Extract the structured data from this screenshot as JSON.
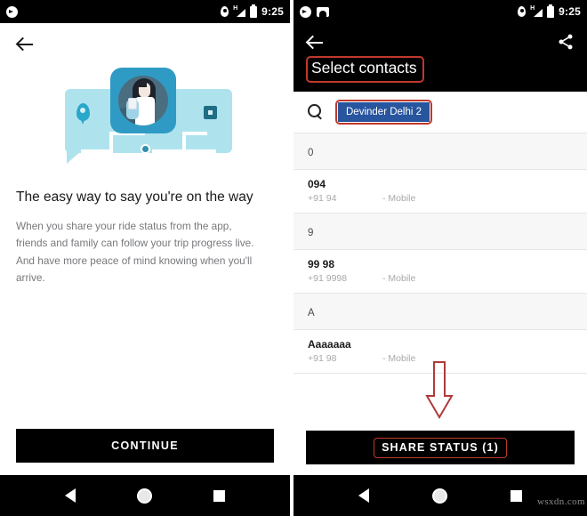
{
  "left_screen": {
    "statusbar": {
      "app_icon": "navigation-app-icon",
      "location_icon": "location-pin-icon",
      "signal_label": "H",
      "battery_icon": "battery-icon",
      "time": "9:25"
    },
    "back_button": "back-arrow",
    "illustration": {
      "name": "share-ride-status-illustration",
      "bubble_color": "#aee3ee",
      "card_color": "#2f9bc4",
      "accent_color": "#29a8c9"
    },
    "headline": "The easy way to say you're on the way",
    "paragraph": "When you share your ride status from the app, friends and family can follow your trip progress live. And have more peace of mind knowing when you'll arrive.",
    "cta_label": "CONTINUE",
    "navbar": {
      "back": "back-triangle",
      "home": "home-circle",
      "recents": "recents-square"
    }
  },
  "right_screen": {
    "statusbar": {
      "app_icon": "navigation-app-icon",
      "photo_icon": "photo-icon",
      "location_icon": "location-pin-icon",
      "signal_label": "H",
      "battery_icon": "battery-icon",
      "time": "9:25"
    },
    "appbar": {
      "back_button": "back-arrow",
      "title": "Select contacts",
      "share_icon": "share-icon"
    },
    "search": {
      "icon": "search-icon",
      "selected_chip": "Devinder Delhi 2"
    },
    "contacts": [
      {
        "kind": "section",
        "label": "0"
      },
      {
        "kind": "contact",
        "name": "094",
        "number": "+91 94",
        "type": "- Mobile"
      },
      {
        "kind": "section",
        "label": "9"
      },
      {
        "kind": "contact",
        "name": "99 98",
        "number": "+91 9998",
        "type": "- Mobile"
      },
      {
        "kind": "section",
        "label": "A"
      },
      {
        "kind": "contact",
        "name": "Aaaaaaa",
        "number": "+91 98",
        "type": "- Mobile"
      }
    ],
    "share_button_label": "SHARE STATUS (1)",
    "annotations": {
      "color": "#c0392b",
      "arrow": "down-arrow-pointing-to-share-button"
    },
    "navbar": {
      "back": "back-triangle",
      "home": "home-circle",
      "recents": "recents-square"
    }
  },
  "watermark": "wsxdn.com"
}
